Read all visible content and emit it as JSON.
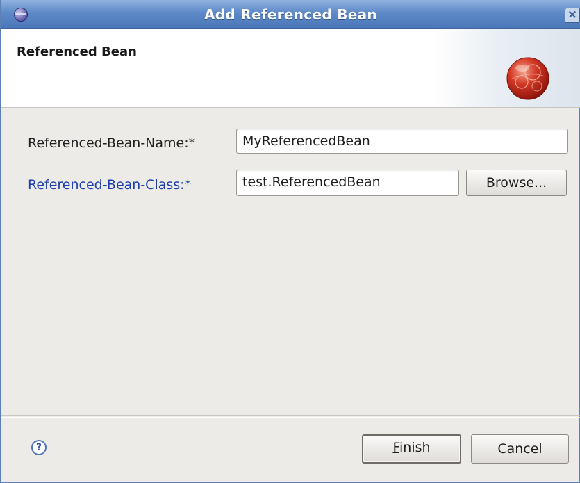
{
  "window": {
    "title": "Add Referenced Bean",
    "close_label": "×"
  },
  "banner": {
    "title": "Referenced Bean",
    "icon": "bean-icon"
  },
  "form": {
    "name_label": "Referenced-Bean-Name:*",
    "name_value": "MyReferencedBean",
    "class_label": "Referenced-Bean-Class:*",
    "class_value": "test.ReferencedBean",
    "browse_label_mnemonic": "B",
    "browse_label_rest": "rowse..."
  },
  "footer": {
    "help_icon": "?",
    "finish_label_mnemonic": "F",
    "finish_label_rest": "inish",
    "cancel_label": "Cancel"
  },
  "colors": {
    "titlebar": "#5d89c7",
    "link": "#1e3fb0",
    "dialog_bg": "#edebe7",
    "banner_bg": "#ffffff"
  }
}
